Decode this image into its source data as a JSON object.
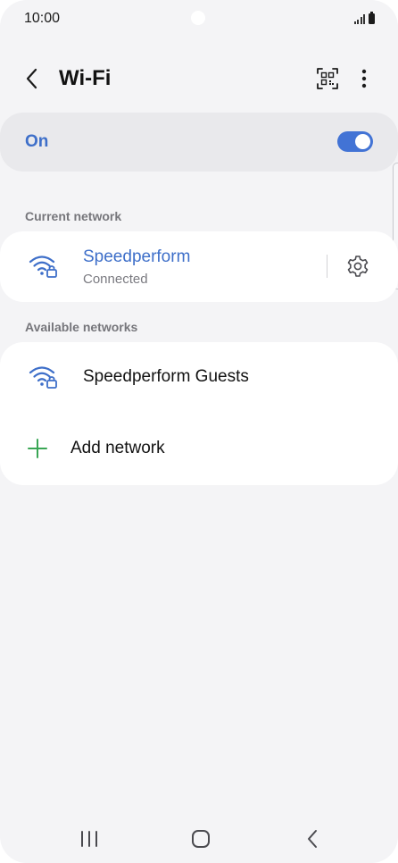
{
  "status_bar": {
    "time": "10:00"
  },
  "app_bar": {
    "title": "Wi-Fi",
    "back_icon": "chevron-left-icon",
    "qr_icon": "qr-code-scan-icon",
    "more_icon": "more-vertical-icon"
  },
  "wifi_toggle": {
    "label": "On",
    "state": "on"
  },
  "current_network": {
    "header": "Current network",
    "name": "Speedperform",
    "status": "Connected",
    "settings_icon": "gear-icon"
  },
  "available_networks": {
    "header": "Available networks",
    "items": [
      {
        "name": "Speedperform Guests",
        "icon": "wifi-locked-icon"
      }
    ],
    "add_label": "Add network"
  },
  "colors": {
    "accent": "#4273d5",
    "accent_text": "#3e6fc9",
    "add_icon": "#3aa655",
    "background": "#f4f4f6",
    "card": "#ffffff"
  }
}
